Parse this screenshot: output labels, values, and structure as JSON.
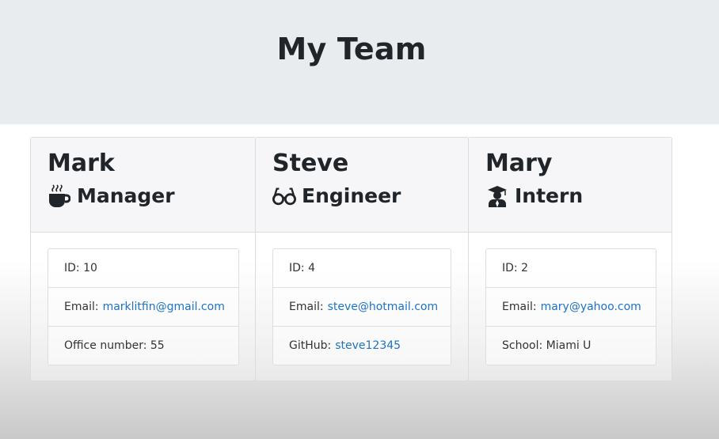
{
  "header": {
    "title": "My Team"
  },
  "cards": [
    {
      "name": "Mark",
      "role": "Manager",
      "role_icon": "coffee-icon",
      "id_text": "ID: 10",
      "email_label": "Email:",
      "email": "marklitfin@gmail.com",
      "extra_label": "Office number: 55",
      "extra_link": ""
    },
    {
      "name": "Steve",
      "role": "Engineer",
      "role_icon": "glasses-icon",
      "id_text": "ID: 4",
      "email_label": "Email:",
      "email": "steve@hotmail.com",
      "extra_label": "GitHub:",
      "extra_link": "steve12345"
    },
    {
      "name": "Mary",
      "role": "Intern",
      "role_icon": "graduate-icon",
      "id_text": "ID: 2",
      "email_label": "Email:",
      "email": "mary@yahoo.com",
      "extra_label": "School: Miami U",
      "extra_link": ""
    }
  ],
  "colors": {
    "header_bg": "#e9ecef",
    "link": "#1e73c8",
    "card_header_bg": "#f6f5f7"
  }
}
